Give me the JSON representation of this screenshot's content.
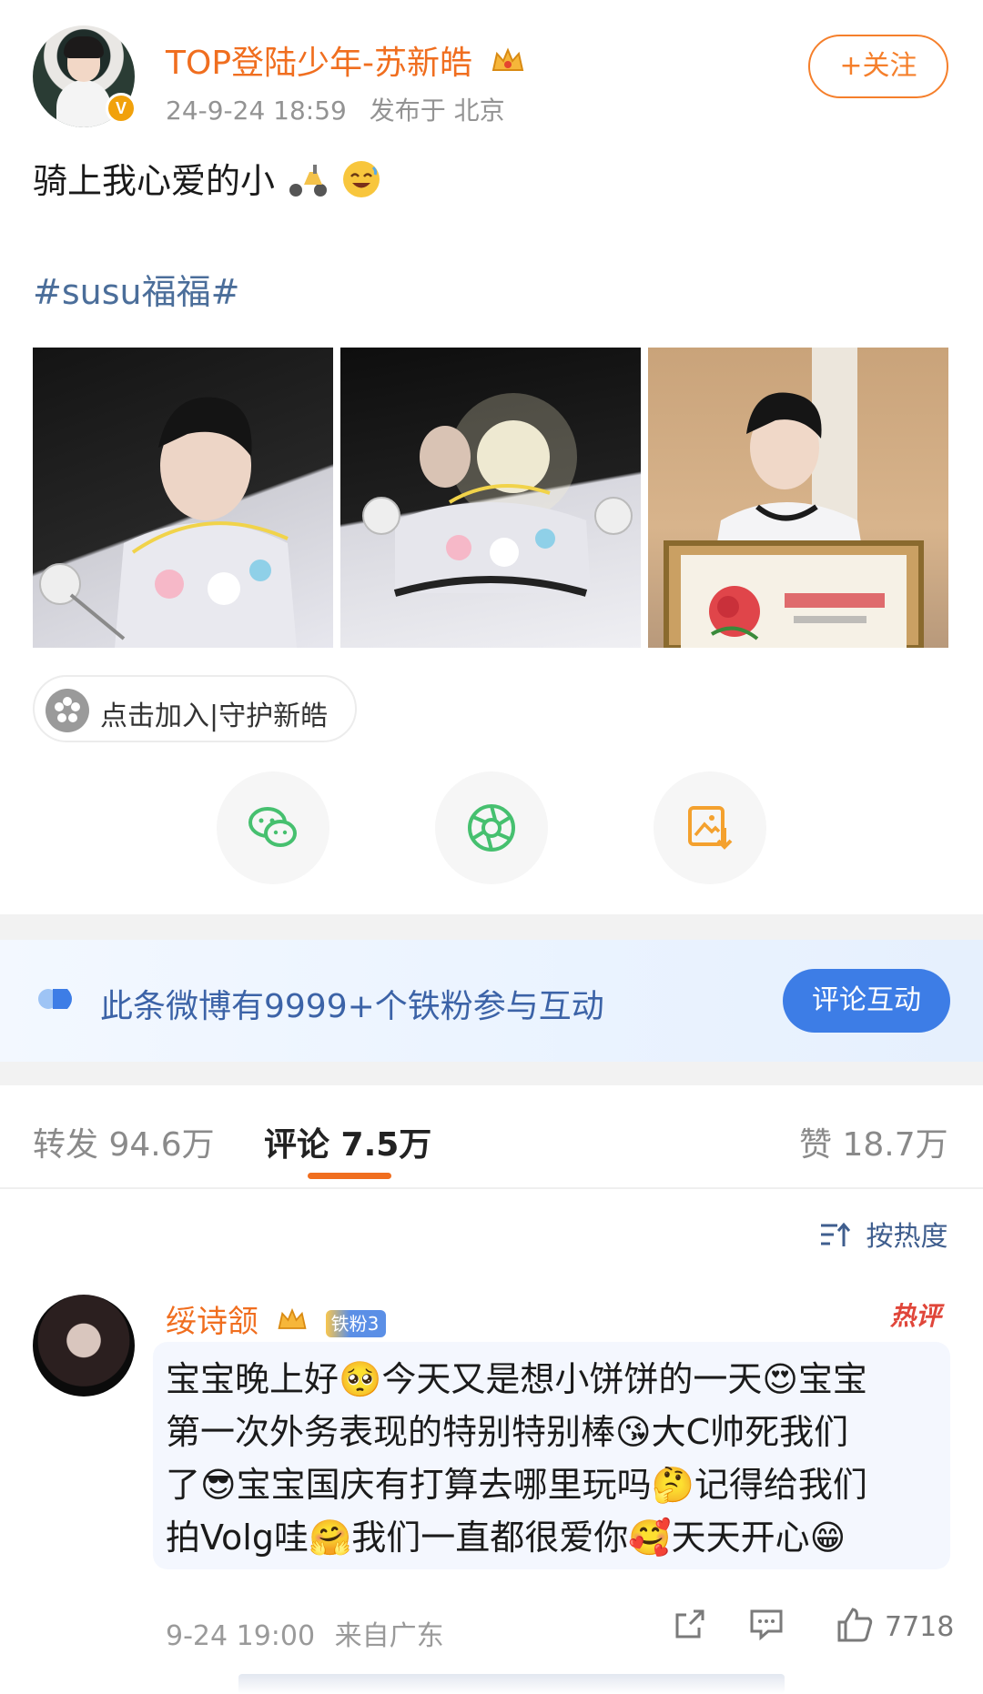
{
  "post": {
    "author": "TOP登陆少年-苏新皓",
    "timestamp": "24-9-24 18:59",
    "location": "发布于 北京",
    "follow_label": "+关注",
    "text": "骑上我心爱的小",
    "hashtag": "#susu福福#",
    "join_label": "点击加入|守护新皓"
  },
  "fans_banner": {
    "text": "此条微博有9999+个铁粉参与互动",
    "button": "评论互动"
  },
  "tabs": {
    "repost": "转发 94.6万",
    "comments": "评论 7.5万",
    "likes": "赞 18.7万"
  },
  "sort_label": "按热度",
  "comment": {
    "author": "绥诗颔",
    "fan_badge": "铁粉3",
    "hot_label": "热评",
    "lines": [
      "宝宝晚上好🥺今天又是想小饼饼的一天😍宝宝",
      "第一次外务表现的特别特别棒😘大C帅死我们",
      "了😎宝宝国庆有打算去哪里玩吗🤔记得给我们",
      "拍Volg哇🤗我们一直都很爱你🥰天天开心😁"
    ],
    "time": "9-24 19:00",
    "location": "来自广东",
    "like_count": "7718"
  },
  "colors": {
    "accent": "#f06e1f",
    "link": "#4b6e9a",
    "banner_button": "#3d7de6"
  },
  "icons": [
    "crown-icon",
    "scooter-icon",
    "laugh-emoji-icon",
    "wechat-icon",
    "moments-icon",
    "save-image-icon",
    "fan-group-icon",
    "sort-icon",
    "share-icon",
    "comment-icon",
    "like-icon"
  ]
}
